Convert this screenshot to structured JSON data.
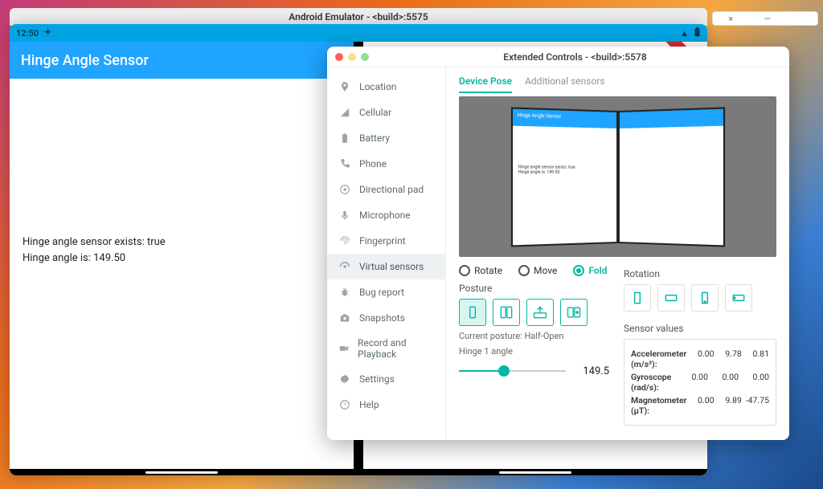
{
  "main_window": {
    "title": "Android Emulator - <build>:5575",
    "status_time": "12:50",
    "app_title": "Hinge Angle Sensor",
    "body_line1": "Hinge angle sensor exists: true",
    "body_line2": "Hinge angle is: 149.50"
  },
  "win_buttons": {
    "close": "×",
    "min": "—"
  },
  "ext": {
    "title": "Extended Controls - <build>:5578",
    "sidebar": [
      {
        "label": "Location",
        "icon": "pin"
      },
      {
        "label": "Cellular",
        "icon": "signal"
      },
      {
        "label": "Battery",
        "icon": "battery"
      },
      {
        "label": "Phone",
        "icon": "phone"
      },
      {
        "label": "Directional pad",
        "icon": "dpad"
      },
      {
        "label": "Microphone",
        "icon": "mic"
      },
      {
        "label": "Fingerprint",
        "icon": "finger"
      },
      {
        "label": "Virtual sensors",
        "icon": "sensors",
        "active": true
      },
      {
        "label": "Bug report",
        "icon": "bug"
      },
      {
        "label": "Snapshots",
        "icon": "camera"
      },
      {
        "label": "Record and Playback",
        "icon": "video"
      },
      {
        "label": "Settings",
        "icon": "gear"
      },
      {
        "label": "Help",
        "icon": "help"
      }
    ],
    "tabs": {
      "active": "Device Pose",
      "other": "Additional sensors"
    },
    "radios": {
      "rotate": "Rotate",
      "move": "Move",
      "fold": "Fold"
    },
    "posture_label": "Posture",
    "current_posture": "Current posture: Half-Open",
    "hinge_label": "Hinge 1 angle",
    "hinge_value": "149.5",
    "rotation_label": "Rotation",
    "sensor_values_label": "Sensor values",
    "sensors": {
      "accel": {
        "label": "Accelerometer (m/s²):",
        "x": "0.00",
        "y": "9.78",
        "z": "0.81"
      },
      "gyro": {
        "label": "Gyroscope (rad/s):",
        "x": "0.00",
        "y": "0.00",
        "z": "0.00"
      },
      "mag": {
        "label": "Magnetometer (µT):",
        "x": "0.00",
        "y": "9.89",
        "z": "-47.75"
      }
    }
  },
  "preview": {
    "mini_title": "Hinge Angle Sensor",
    "mini_line1": "Hinge angle sensor exists: true",
    "mini_line2": "Hinge angle is: 149.50"
  }
}
